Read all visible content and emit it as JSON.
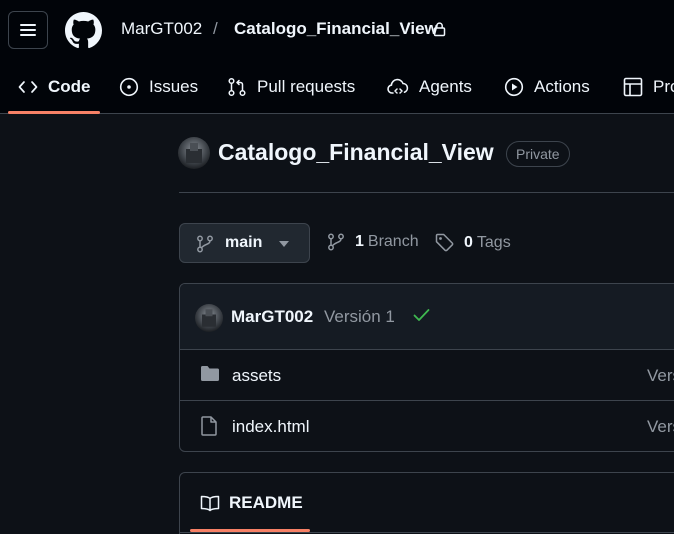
{
  "header": {
    "owner": "MarGT002",
    "separator": "/",
    "repo": "Catalogo_Financial_View"
  },
  "nav": {
    "tabs": [
      {
        "label": "Code",
        "icon": "code-icon",
        "active": true
      },
      {
        "label": "Issues",
        "icon": "issue-icon"
      },
      {
        "label": "Pull requests",
        "icon": "pull-request-icon"
      },
      {
        "label": "Agents",
        "icon": "agent-icon"
      },
      {
        "label": "Actions",
        "icon": "play-icon"
      },
      {
        "label": "Pro",
        "icon": "table-icon"
      }
    ]
  },
  "repo": {
    "title": "Catalogo_Financial_View",
    "visibility": "Private"
  },
  "branch": {
    "current": "main",
    "branch_count": "1",
    "branch_label": "Branch",
    "tag_count": "0",
    "tag_label": "Tags"
  },
  "commit": {
    "author": "MarGT002",
    "message": "Versión 1",
    "status": "success"
  },
  "files": [
    {
      "name": "assets",
      "type": "folder",
      "commit": "Vers"
    },
    {
      "name": "index.html",
      "type": "file",
      "commit": "Vers"
    }
  ],
  "readme": {
    "label": "README"
  },
  "colors": {
    "background": "#0d1117",
    "header": "#010409",
    "border": "#3d444d",
    "accent": "#f78166",
    "success": "#3fb950",
    "muted": "#9198a1"
  }
}
